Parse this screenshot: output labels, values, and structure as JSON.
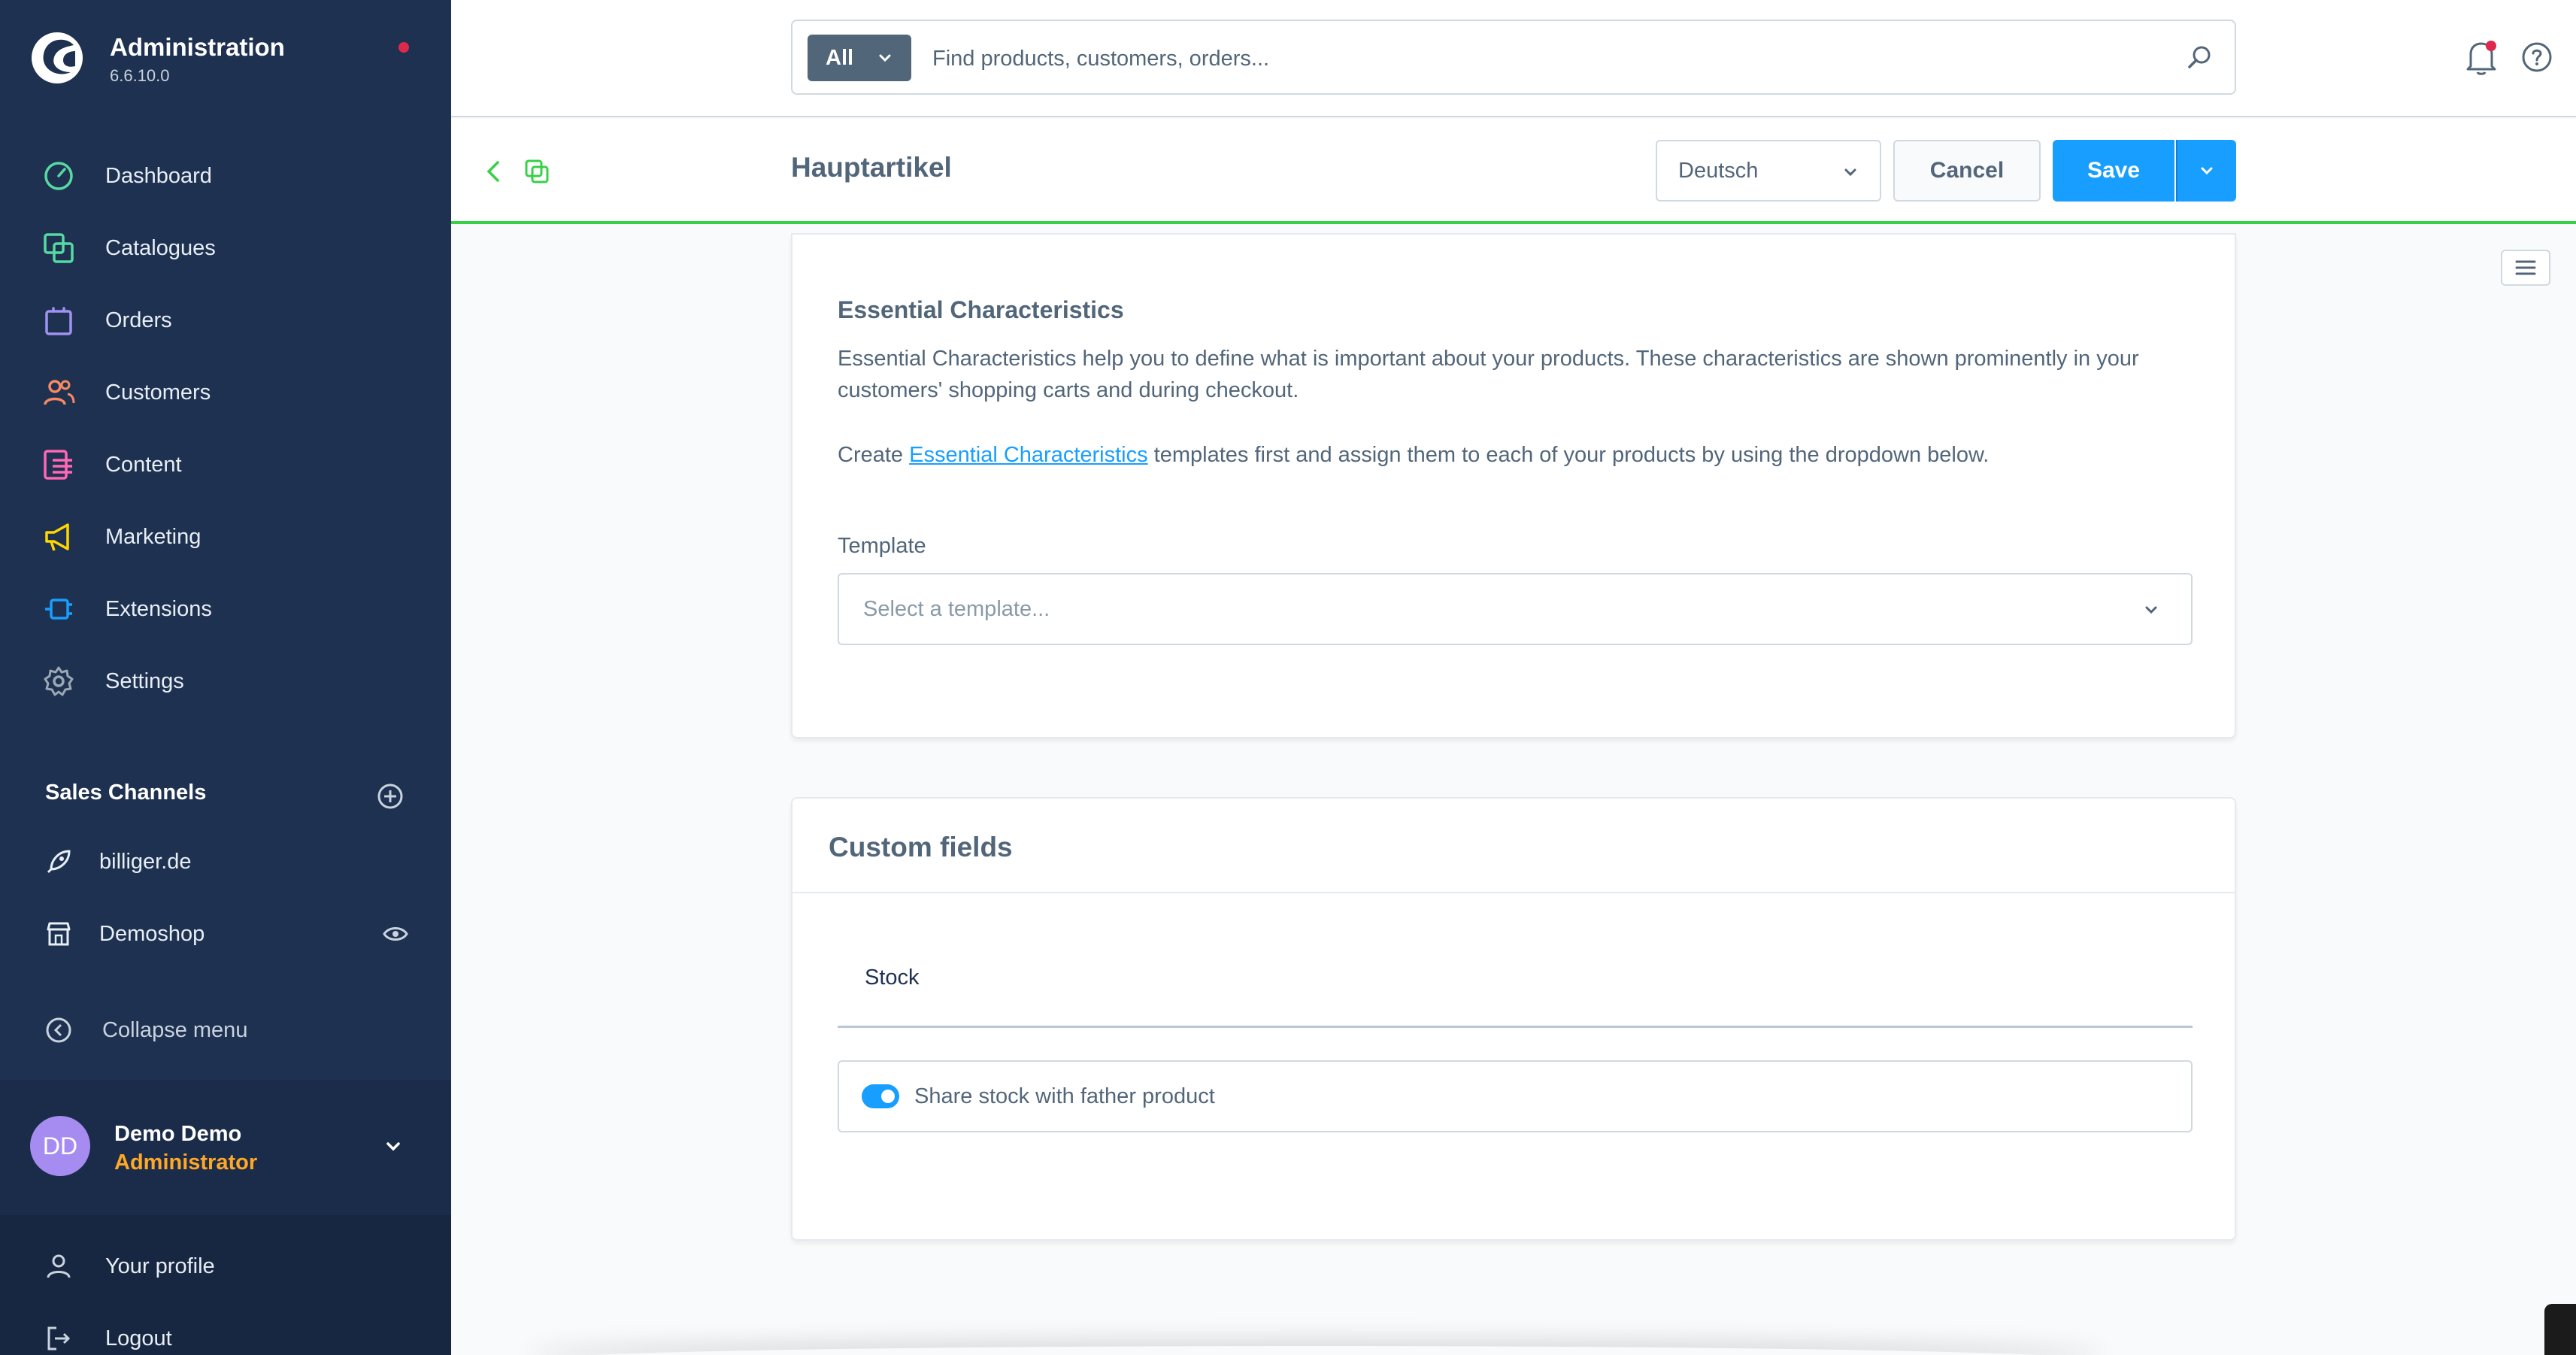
{
  "app": {
    "title": "Administration",
    "version": "6.6.10.0"
  },
  "sidebar": {
    "items": [
      {
        "label": "Dashboard",
        "icon": "dashboard-icon",
        "color": "#57d9a3"
      },
      {
        "label": "Catalogues",
        "icon": "catalogues-icon",
        "color": "#57d9a3"
      },
      {
        "label": "Orders",
        "icon": "orders-icon",
        "color": "#a092f0"
      },
      {
        "label": "Customers",
        "icon": "customers-icon",
        "color": "#f88962"
      },
      {
        "label": "Content",
        "icon": "content-icon",
        "color": "#ff68b4"
      },
      {
        "label": "Marketing",
        "icon": "marketing-icon",
        "color": "#ffd700"
      },
      {
        "label": "Extensions",
        "icon": "extensions-icon",
        "color": "#189eff"
      },
      {
        "label": "Settings",
        "icon": "settings-icon",
        "color": "#9aa8b5"
      }
    ],
    "sales_channels_title": "Sales Channels",
    "sales_channels": [
      {
        "label": "billiger.de",
        "icon": "rocket-icon"
      },
      {
        "label": "Demoshop",
        "icon": "storefront-icon"
      }
    ],
    "collapse_label": "Collapse menu",
    "user": {
      "initials": "DD",
      "name": "Demo Demo",
      "role": "Administrator"
    },
    "bottom": [
      {
        "label": "Your profile",
        "icon": "user-icon"
      },
      {
        "label": "Logout",
        "icon": "logout-icon"
      }
    ]
  },
  "search": {
    "type_label": "All",
    "placeholder": "Find products, customers, orders..."
  },
  "smartbar": {
    "title": "Hauptartikel",
    "language": "Deutsch",
    "cancel_label": "Cancel",
    "save_label": "Save"
  },
  "essential": {
    "title": "Essential Characteristics",
    "description": "Essential Characteristics help you to define what is important about your products. These characteristics are shown prominently in your customers' shopping carts and during checkout.",
    "create_prefix": "Create ",
    "create_link": "Essential Characteristics",
    "create_suffix": " templates first and assign them to each of your products by using the dropdown below.",
    "template_label": "Template",
    "template_placeholder": "Select a template..."
  },
  "custom_fields": {
    "title": "Custom fields",
    "tab_label": "Stock",
    "toggle_label": "Share stock with father product",
    "toggle_on": true
  },
  "colors": {
    "accent": "#189eff",
    "sidebar_bg": "#1e3150",
    "success_line": "#37d046"
  }
}
